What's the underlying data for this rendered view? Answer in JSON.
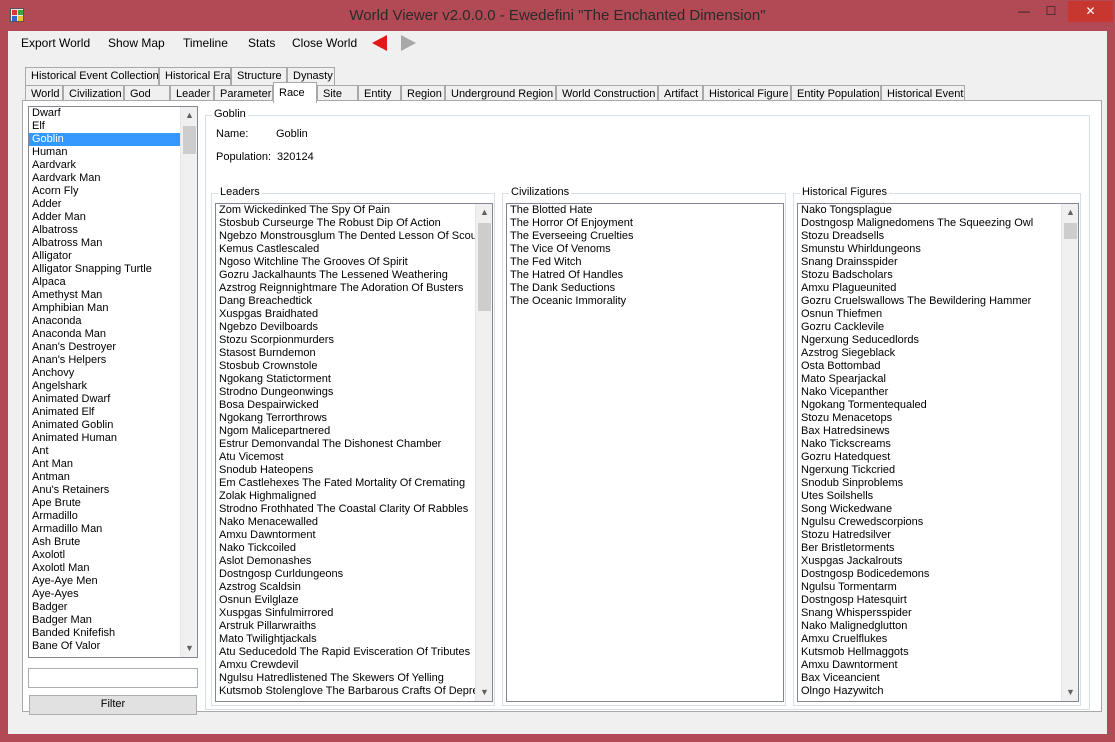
{
  "window": {
    "title": "World Viewer v2.0.0.0 - Ewedefini \"The Enchanted Dimension\"",
    "minimize": "—",
    "maximize": "☐",
    "close": "✕"
  },
  "menu": [
    "Export World",
    "Show Map",
    "Timeline",
    "Stats",
    "Close World"
  ],
  "tabs_row1": [
    "Historical Event Collection",
    "Historical Era",
    "Structure",
    "Dynasty"
  ],
  "tabs_row2": [
    "World",
    "Civilization",
    "God",
    "Leader",
    "Parameter",
    "Race",
    "Site",
    "Entity",
    "Region",
    "Underground Region",
    "World Construction",
    "Artifact",
    "Historical Figure",
    "Entity Population",
    "Historical Event"
  ],
  "selected_tab": "Race",
  "race_list": {
    "items": [
      "Dwarf",
      "Elf",
      "Goblin",
      "Human",
      "Aardvark",
      "Aardvark Man",
      "Acorn Fly",
      "Adder",
      "Adder Man",
      "Albatross",
      "Albatross Man",
      "Alligator",
      "Alligator Snapping Turtle",
      "Alpaca",
      "Amethyst Man",
      "Amphibian Man",
      "Anaconda",
      "Anaconda Man",
      "Anan's Destroyer",
      "Anan's Helpers",
      "Anchovy",
      "Angelshark",
      "Animated Dwarf",
      "Animated Elf",
      "Animated Goblin",
      "Animated Human",
      "Ant",
      "Ant Man",
      "Antman",
      "Anu's Retainers",
      "Ape Brute",
      "Armadillo",
      "Armadillo Man",
      "Ash Brute",
      "Axolotl",
      "Axolotl Man",
      "Aye-Aye Men",
      "Aye-Ayes",
      "Badger",
      "Badger Man",
      "Banded Knifefish",
      "Bane Of Valor"
    ],
    "selected": "Goblin"
  },
  "filter": {
    "value": "",
    "button_label": "Filter"
  },
  "detail": {
    "group_title": "Goblin",
    "name_label": "Name:",
    "name_value": "Goblin",
    "population_label": "Population:",
    "population_value": "320124"
  },
  "leaders": {
    "title": "Leaders",
    "items": [
      "Zom Wickedinked The Spy Of Pain",
      "Stosbub Curseurge The Robust Dip Of Action",
      "Ngebzo Monstrousglum The Dented Lesson Of Scourg",
      "Kemus Castlescaled",
      "Ngoso Witchline The Grooves Of Spirit",
      "Gozru Jackalhaunts The Lessened Weathering",
      "Azstrog Reignnightmare The Adoration Of Busters",
      "Dang Breachedtick",
      "Xuspgas Braidhated",
      "Ngebzo Devilboards",
      "Stozu Scorpionmurders",
      "Stasost Burndemon",
      "Stosbub Crownstole",
      "Ngokang Statictorment",
      "Strodno Dungeonwings",
      "Bosa Despairwicked",
      "Ngokang Terrorthrows",
      "Ngom Malicepartnered",
      "Estrur Demonvandal The Dishonest Chamber",
      "Atu Vicemost",
      "Snodub Hateopens",
      "Em Castlehexes The Fated Mortality Of Cremating",
      "Zolak Highmaligned",
      "Strodno Frothhated The Coastal Clarity Of Rabbles",
      "Nako Menacewalled",
      "Amxu Dawntorment",
      "Nako Tickcoiled",
      "Aslot Demonashes",
      "Dostngosp Curldungeons",
      "Azstrog Scaldsin",
      "Osnun Evilglaze",
      "Xuspgas Sinfulmirrored",
      "Arstruk Pillarwraiths",
      "Mato Twilightjackals",
      "Atu Seducedold The Rapid Evisceration Of Tributes",
      "Amxu Crewdevil",
      "Ngulsu Hatredlistened The Skewers Of Yelling",
      "Kutsmob Stolenglove The Barbarous Crafts Of Depress"
    ]
  },
  "civilizations": {
    "title": "Civilizations",
    "items": [
      "The Blotted Hate",
      "The Horror Of Enjoyment",
      "The Everseeing Cruelties",
      "The Vice Of Venoms",
      "The Fed Witch",
      "The Hatred Of Handles",
      "The Dank Seductions",
      "The Oceanic Immorality"
    ]
  },
  "historical_figures": {
    "title": "Historical Figures",
    "items": [
      "Nako Tongsplague",
      "Dostngosp Malignedomens The Squeezing Owl",
      "Stozu Dreadsells",
      "Smunstu Whirldungeons",
      "Snang Drainsspider",
      "Stozu Badscholars",
      "Amxu Plagueunited",
      "Gozru Cruelswallows The Bewildering Hammer",
      "Osnun Thiefmen",
      "Gozru Cacklevile",
      "Ngerxung Seducedlords",
      "Azstrog Siegeblack",
      "Osta Bottombad",
      "Mato Spearjackal",
      "Nako Vicepanther",
      "Ngokang Tormentequaled",
      "Stozu Menacetops",
      "Bax Hatredsinews",
      "Nako Tickscreams",
      "Gozru Hatedquest",
      "Ngerxung Tickcried",
      "Snodub Sinproblems",
      "Utes Soilshells",
      "Song Wickedwane",
      "Ngulsu Crewedscorpions",
      "Stozu Hatredsilver",
      "Ber Bristletorments",
      "Xuspgas Jackalrouts",
      "Dostngosp Bodicedemons",
      "Ngulsu Tormentarm",
      "Dostngosp Hatesquirt",
      "Snang Whispersspider",
      "Nako Malignedglutton",
      "Amxu Cruelflukes",
      "Kutsmob Hellmaggots",
      "Amxu Dawntorment",
      "Bax Viceancient",
      "Olngo Hazywitch"
    ]
  },
  "icons": {
    "nav_back": "arrow-left-icon",
    "nav_forward": "arrow-right-icon",
    "scroll_up": "▲",
    "scroll_down": "▼"
  },
  "colors": {
    "frame": "#b14a54",
    "selection": "#3399ff",
    "back_arrow": "#e21818",
    "forward_arrow": "#a8a8a8"
  }
}
